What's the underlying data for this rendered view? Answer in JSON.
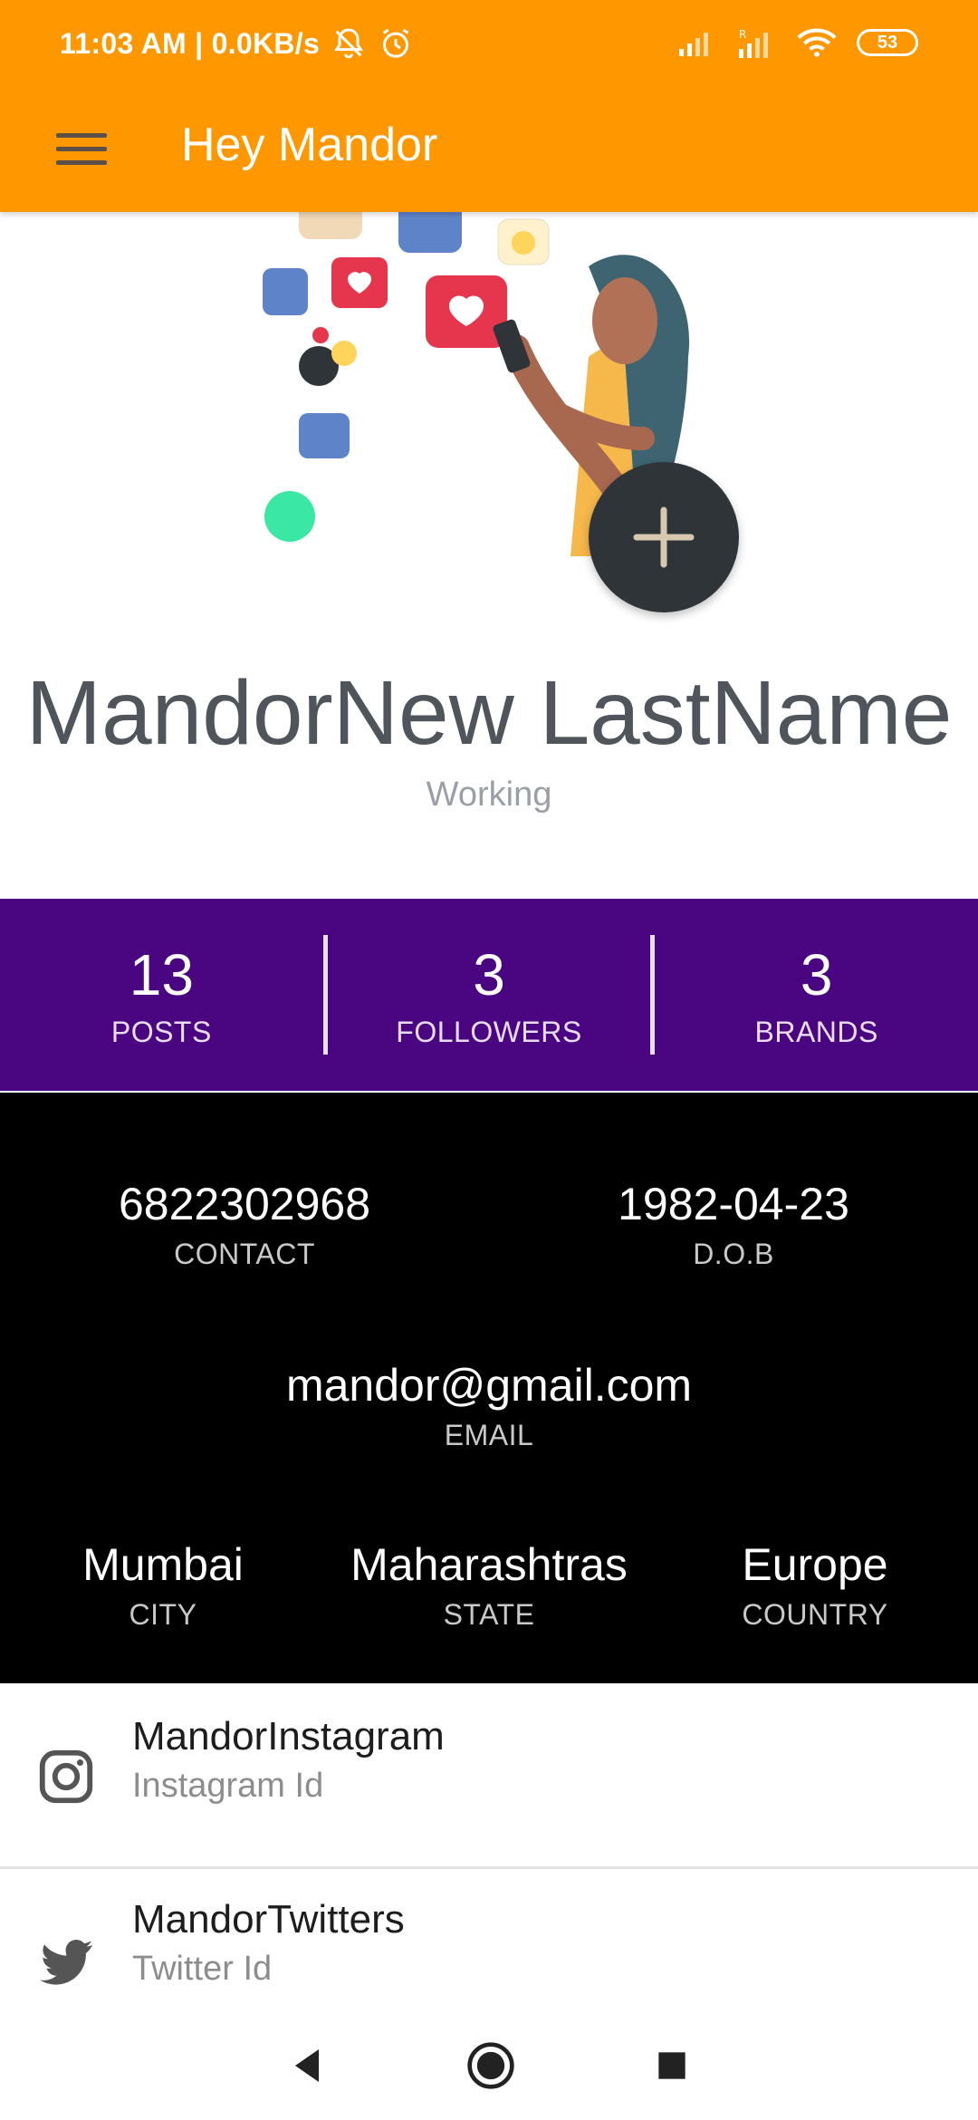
{
  "status_bar": {
    "time_speed": "11:03 AM | 0.0KB/s",
    "battery": "53"
  },
  "toolbar": {
    "title": "Hey Mandor"
  },
  "profile": {
    "name": "MandorNew LastName",
    "status": "Working"
  },
  "stats": [
    {
      "value": "13",
      "label": "POSTS"
    },
    {
      "value": "3",
      "label": "FOLLOWERS"
    },
    {
      "value": "3",
      "label": "BRANDS"
    }
  ],
  "details": {
    "contact": {
      "value": "6822302968",
      "label": "CONTACT"
    },
    "dob": {
      "value": "1982-04-23",
      "label": "D.O.B"
    },
    "email": {
      "value": "mandor@gmail.com",
      "label": "EMAIL"
    },
    "city": {
      "value": "Mumbai",
      "label": "CITY"
    },
    "state": {
      "value": "Maharashtras",
      "label": "STATE"
    },
    "country": {
      "value": "Europe",
      "label": "COUNTRY"
    }
  },
  "social": [
    {
      "title": "MandorInstagram",
      "subtitle": "Instagram Id",
      "icon": "instagram-icon"
    },
    {
      "title": "MandorTwitters",
      "subtitle": "Twitter Id",
      "icon": "twitter-icon"
    }
  ],
  "colors": {
    "appbar": "#FF9800",
    "stats_band": "#4A0680",
    "details_band": "#000000",
    "fab": "#2f3438"
  }
}
